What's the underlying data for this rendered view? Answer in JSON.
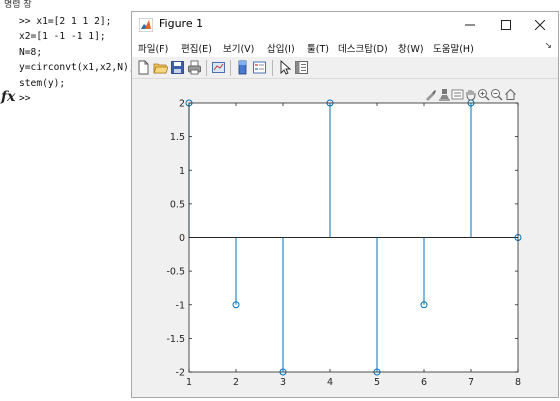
{
  "command_window": {
    "panel_title": "명령 창",
    "prompt_symbol": "fx",
    "lines": [
      ">> x1=[2 1 1 2];",
      "x2=[1 -1 -1 1];",
      "N=8;",
      "y=circonvt(x1,x2,N);",
      "stem(y);",
      ">>"
    ]
  },
  "figure": {
    "title": "Figure 1",
    "menu": [
      "파일(F)",
      "편집(E)",
      "보기(V)",
      "삽입(I)",
      "툴(T)",
      "데스크탑(D)",
      "창(W)",
      "도움말(H)"
    ],
    "menu_overflow": "↘",
    "toolbar_icons": [
      "new-figure-icon",
      "open-file-icon",
      "save-icon",
      "print-icon",
      "link-plot-icon",
      "colorbar-icon",
      "legend-icon",
      "pointer-icon",
      "property-inspector-icon"
    ],
    "axes_toolbar_icons": [
      "brush-icon",
      "data-tips-icon",
      "zoom-hover-icon",
      "pan-icon",
      "zoom-in-icon",
      "zoom-out-icon",
      "home-icon"
    ],
    "colors": {
      "stem": "#0072BD",
      "axes_bg": "#ffffff",
      "figure_bg": "#f0f0f0"
    }
  },
  "chart_data": {
    "type": "stem",
    "x": [
      1,
      2,
      3,
      4,
      5,
      6,
      7,
      8
    ],
    "y": [
      2,
      -1,
      -2,
      2,
      -2,
      -1,
      2,
      0
    ],
    "xlim": [
      1,
      8
    ],
    "ylim": [
      -2,
      2
    ],
    "xticks": [
      "1",
      "2",
      "3",
      "4",
      "5",
      "6",
      "7",
      "8"
    ],
    "yticks": [
      "-2",
      "-1.5",
      "-1",
      "-0.5",
      "0",
      "0.5",
      "1",
      "1.5",
      "2"
    ],
    "baseline": 0,
    "grid": false
  }
}
